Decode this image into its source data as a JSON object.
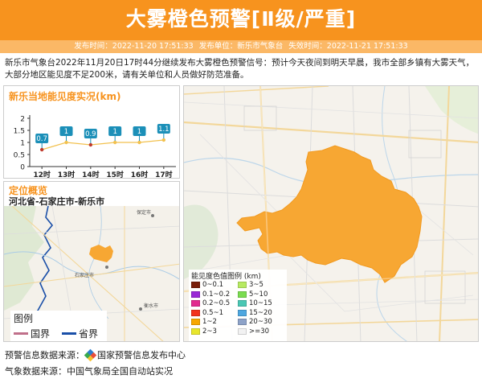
{
  "header": {
    "title": "大雾橙色预警[Ⅱ级/严重]",
    "publish_time": "发布时间：2022-11-20 17:51:33",
    "publisher": "发布单位：新乐市气象台",
    "expire_time": "失效时间：2022-11-21 17:51:33"
  },
  "description": "新乐市气象台2022年11月20日17时44分继续发布大雾橙色预警信号：预计今天夜间到明天早晨，我市全部乡镇有大雾天气，大部分地区能见度不足200米，请有关单位和人员做好防范准备。",
  "visibility_panel": {
    "title": "新乐当地能见度实况(km)"
  },
  "chart_data": {
    "type": "line",
    "categories": [
      "12时",
      "13时",
      "14时",
      "15时",
      "16时",
      "17时"
    ],
    "values": [
      0.7,
      1,
      0.9,
      1,
      1,
      1.1
    ],
    "value_labels": [
      "0.7",
      "1",
      "0.9",
      "1",
      "1",
      "1.1"
    ],
    "yticks": [
      "0",
      "0.5",
      "1",
      "1.5",
      "2"
    ],
    "ylim": [
      0,
      2
    ],
    "line_color": "#f2c14e",
    "point_colors": [
      "#c0392b",
      "#f2c14e",
      "#c0392b",
      "#f2c14e",
      "#f2c14e",
      "#f2c14e"
    ],
    "label_color": "#1b8fb8"
  },
  "location_panel": {
    "title": "定位概览",
    "path": "河北省-石家庄市-新乐市",
    "city_labels": [
      "保定市",
      "石家庄市",
      "衡水市"
    ],
    "legend_title": "图例",
    "legend_items": [
      {
        "label": "国界",
        "color": "#c0708a"
      },
      {
        "label": "省界",
        "color": "#1a4fa8"
      }
    ]
  },
  "legend": {
    "title": "能见度色值图例 (km)",
    "items": [
      {
        "label": "0~0.1",
        "color": "#7a1f0a"
      },
      {
        "label": "3~5",
        "color": "#b7ea61"
      },
      {
        "label": "0.1~0.2",
        "color": "#9a2ad6"
      },
      {
        "label": "5~10",
        "color": "#7bdc50"
      },
      {
        "label": "0.2~0.5",
        "color": "#e22a8e"
      },
      {
        "label": "10~15",
        "color": "#49c7b4"
      },
      {
        "label": "0.5~1",
        "color": "#f2321e"
      },
      {
        "label": "15~20",
        "color": "#4ea7e0"
      },
      {
        "label": "1~2",
        "color": "#f7a700"
      },
      {
        "label": "20~30",
        "color": "#8ea3c8"
      },
      {
        "label": "2~3",
        "color": "#e8e62c"
      },
      {
        "label": ">=30",
        "color": "#f2f2f2"
      }
    ]
  },
  "footer": {
    "source_label": "预警信息数据来源：",
    "source_name": "国家预警信息发布中心",
    "weather_source": "气象数据来源：中国气象局全国自动站实况"
  },
  "colors": {
    "accent": "#f7931e",
    "fog_area": "#f7a733"
  }
}
